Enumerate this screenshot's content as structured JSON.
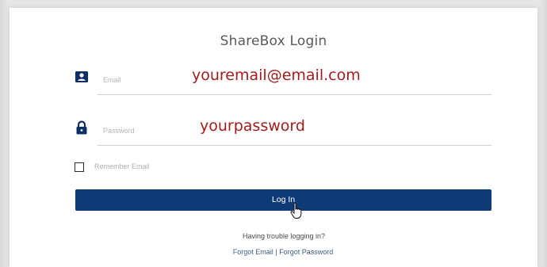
{
  "login": {
    "title": "ShareBox Login",
    "email": {
      "placeholder": "Email",
      "value": "youremail@email.com",
      "icon": "contact-card-icon"
    },
    "password": {
      "placeholder": "Password",
      "value": "yourpassword",
      "icon": "lock-icon"
    },
    "remember_label": "Remember Email",
    "login_button": "Log In",
    "trouble_text": "Having trouble logging in?",
    "forgot_email": "Forgot Email",
    "separator": "|",
    "forgot_password": "Forgot Password"
  },
  "colors": {
    "button": "#0c3b78",
    "typed_text": "#a31c1c",
    "link": "#3d5c8a"
  }
}
